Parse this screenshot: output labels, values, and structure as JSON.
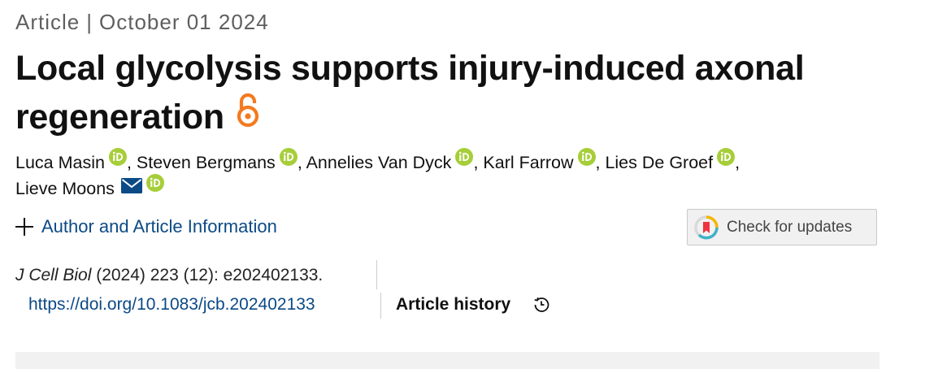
{
  "meta": {
    "type": "Article",
    "separator": "|",
    "date": "October 01 2024"
  },
  "title": "Local glycolysis supports injury-induced axonal regeneration",
  "icons": {
    "open_access": "open-access-lock-icon",
    "orcid": "orcid-icon",
    "mail": "envelope-icon",
    "history": "history-clock-icon",
    "expand": "plus-icon",
    "crossmark": "crossmark-icon"
  },
  "authors": [
    {
      "name": "Luca Masin",
      "suffix": ", ",
      "orcid": true,
      "mail": false
    },
    {
      "name": "Steven Bergmans",
      "suffix": ", ",
      "orcid": true,
      "mail": false
    },
    {
      "name": "Annelies Van Dyck",
      "suffix": ", ",
      "orcid": true,
      "mail": false
    },
    {
      "name": "Karl Farrow",
      "suffix": ", ",
      "orcid": true,
      "mail": false
    },
    {
      "name": "Lies De Groef",
      "suffix": ",",
      "orcid": true,
      "mail": false
    },
    {
      "name": "Lieve Moons",
      "suffix": "",
      "orcid": true,
      "mail": true
    }
  ],
  "info_toggle_label": "Author and Article Information",
  "check_updates_label": "Check for updates",
  "citation": {
    "journal": "J Cell Biol",
    "details": " (2024) 223 (12): e202402133."
  },
  "doi": "https://doi.org/10.1083/jcb.202402133",
  "article_history_label": "Article history",
  "colors": {
    "link": "#0c4a86",
    "orcid": "#a6ce39",
    "open_access": "#f47a20",
    "mail": "#0c4a86",
    "meta": "#5f5f5f"
  }
}
